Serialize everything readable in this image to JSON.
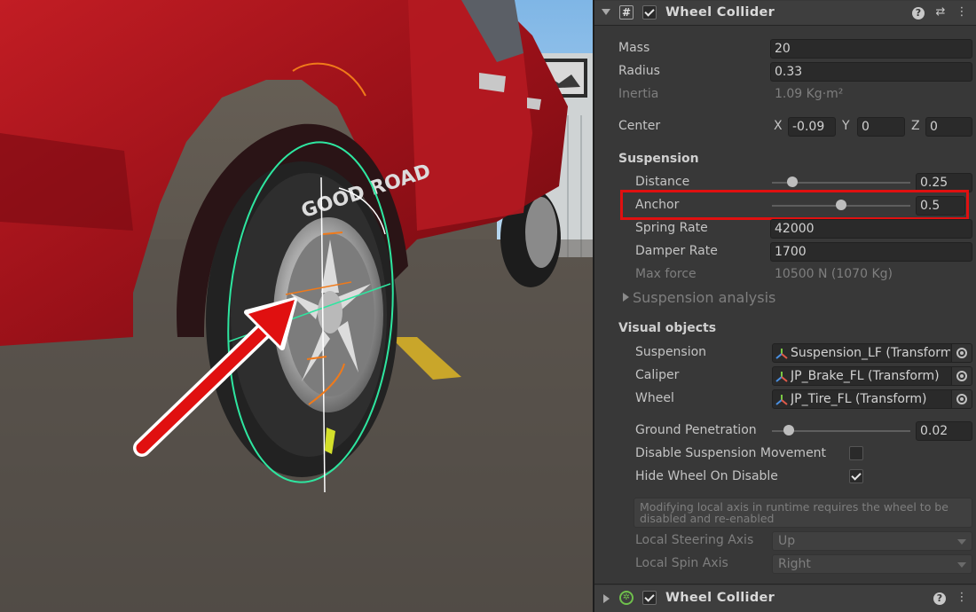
{
  "component": {
    "title": "Wheel Collider",
    "collapsed_title": "Wheel Collider"
  },
  "fields": {
    "mass": {
      "label": "Mass",
      "value": "20"
    },
    "radius": {
      "label": "Radius",
      "value": "0.33"
    },
    "inertia": {
      "label": "Inertia",
      "value": "1.09 Kg·m²"
    },
    "center": {
      "label": "Center",
      "x_label": "X",
      "x": "-0.09",
      "y_label": "Y",
      "y": "0",
      "z_label": "Z",
      "z": "0"
    }
  },
  "suspension": {
    "heading": "Suspension",
    "distance": {
      "label": "Distance",
      "value": "0.25",
      "slider_fraction": 0.15
    },
    "anchor": {
      "label": "Anchor",
      "value": "0.5",
      "slider_fraction": 0.5
    },
    "spring_rate": {
      "label": "Spring Rate",
      "value": "42000"
    },
    "damper_rate": {
      "label": "Damper Rate",
      "value": "1700"
    },
    "max_force": {
      "label": "Max force",
      "value": "10500 N  (1070 Kg)"
    },
    "analysis_label": "Suspension analysis"
  },
  "visual": {
    "heading": "Visual objects",
    "suspension": {
      "label": "Suspension",
      "value": "Suspension_LF (Transform)"
    },
    "caliper": {
      "label": "Caliper",
      "value": "JP_Brake_FL (Transform)"
    },
    "wheel": {
      "label": "Wheel",
      "value": "JP_Tire_FL (Transform)"
    },
    "ground_penetration": {
      "label": "Ground Penetration",
      "value": "0.02",
      "slider_fraction": 0.12
    },
    "disable_suspension": {
      "label": "Disable Suspension Movement",
      "checked": false
    },
    "hide_wheel": {
      "label": "Hide Wheel On Disable",
      "checked": true
    },
    "help_text": "Modifying local axis in runtime requires the wheel to be disabled and re-enabled",
    "steering_axis": {
      "label": "Local Steering Axis",
      "value": "Up"
    },
    "spin_axis": {
      "label": "Local Spin Axis",
      "value": "Right"
    }
  },
  "scene": {
    "tire_text": "GOOD ROAD"
  },
  "colors": {
    "highlight": "#e01010",
    "gizmo_green": "#2ee6a0",
    "gizmo_orange": "#f07a1a",
    "car_red": "#a8141c"
  }
}
